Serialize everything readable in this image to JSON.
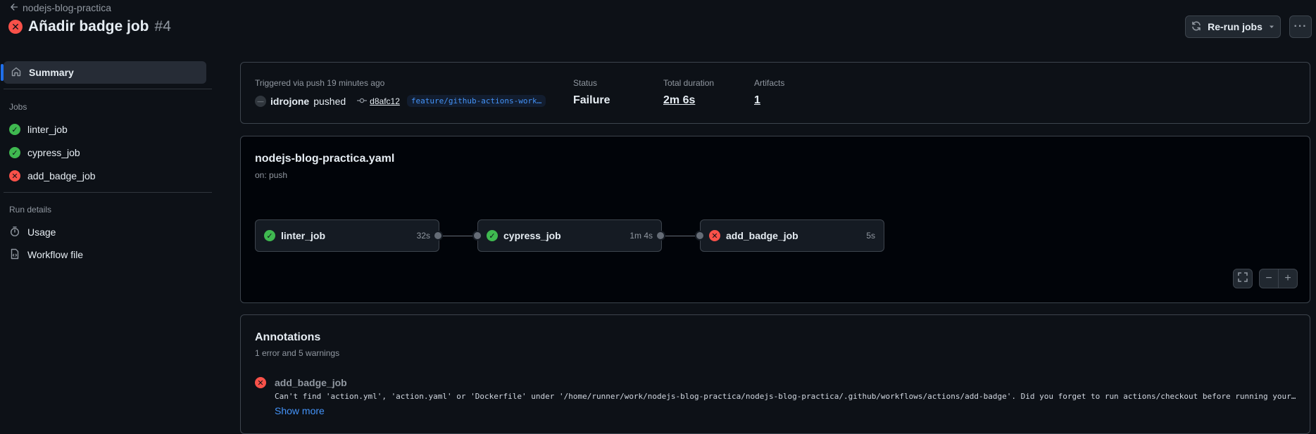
{
  "header": {
    "back_label": "nodejs-blog-practica",
    "title": "Añadir badge job",
    "run_number": "#4",
    "rerun_label": "Re-run jobs"
  },
  "sidebar": {
    "summary_label": "Summary",
    "jobs_heading": "Jobs",
    "jobs": [
      {
        "label": "linter_job",
        "status": "success"
      },
      {
        "label": "cypress_job",
        "status": "success"
      },
      {
        "label": "add_badge_job",
        "status": "failure"
      }
    ],
    "run_details_heading": "Run details",
    "usage_label": "Usage",
    "workflow_file_label": "Workflow file"
  },
  "summary": {
    "triggered_text": "Triggered via push 19 minutes ago",
    "user": "idrojone",
    "action": "pushed",
    "commit": "d8afc12",
    "branch": "feature/github-actions-work…",
    "status_label": "Status",
    "status_value": "Failure",
    "duration_label": "Total duration",
    "duration_value": "2m 6s",
    "artifacts_label": "Artifacts",
    "artifacts_value": "1"
  },
  "workflow": {
    "file": "nodejs-blog-practica.yaml",
    "trigger": "on: push",
    "jobs": [
      {
        "name": "linter_job",
        "duration": "32s",
        "status": "success"
      },
      {
        "name": "cypress_job",
        "duration": "1m 4s",
        "status": "success"
      },
      {
        "name": "add_badge_job",
        "duration": "5s",
        "status": "failure"
      }
    ]
  },
  "annotations": {
    "heading": "Annotations",
    "subtitle": "1 error and 5 warnings",
    "items": [
      {
        "job": "add_badge_job",
        "message": "Can't find 'action.yml', 'action.yaml' or 'Dockerfile' under '/home/runner/work/nodejs-blog-practica/nodejs-blog-practica/.github/workflows/actions/add-badge'. Did you forget to run actions/checkout before running your …",
        "show_more": "Show more"
      }
    ]
  },
  "colors": {
    "success": "#3fb950",
    "failure": "#f85149",
    "link": "#4493f8",
    "background": "#0d1117"
  }
}
